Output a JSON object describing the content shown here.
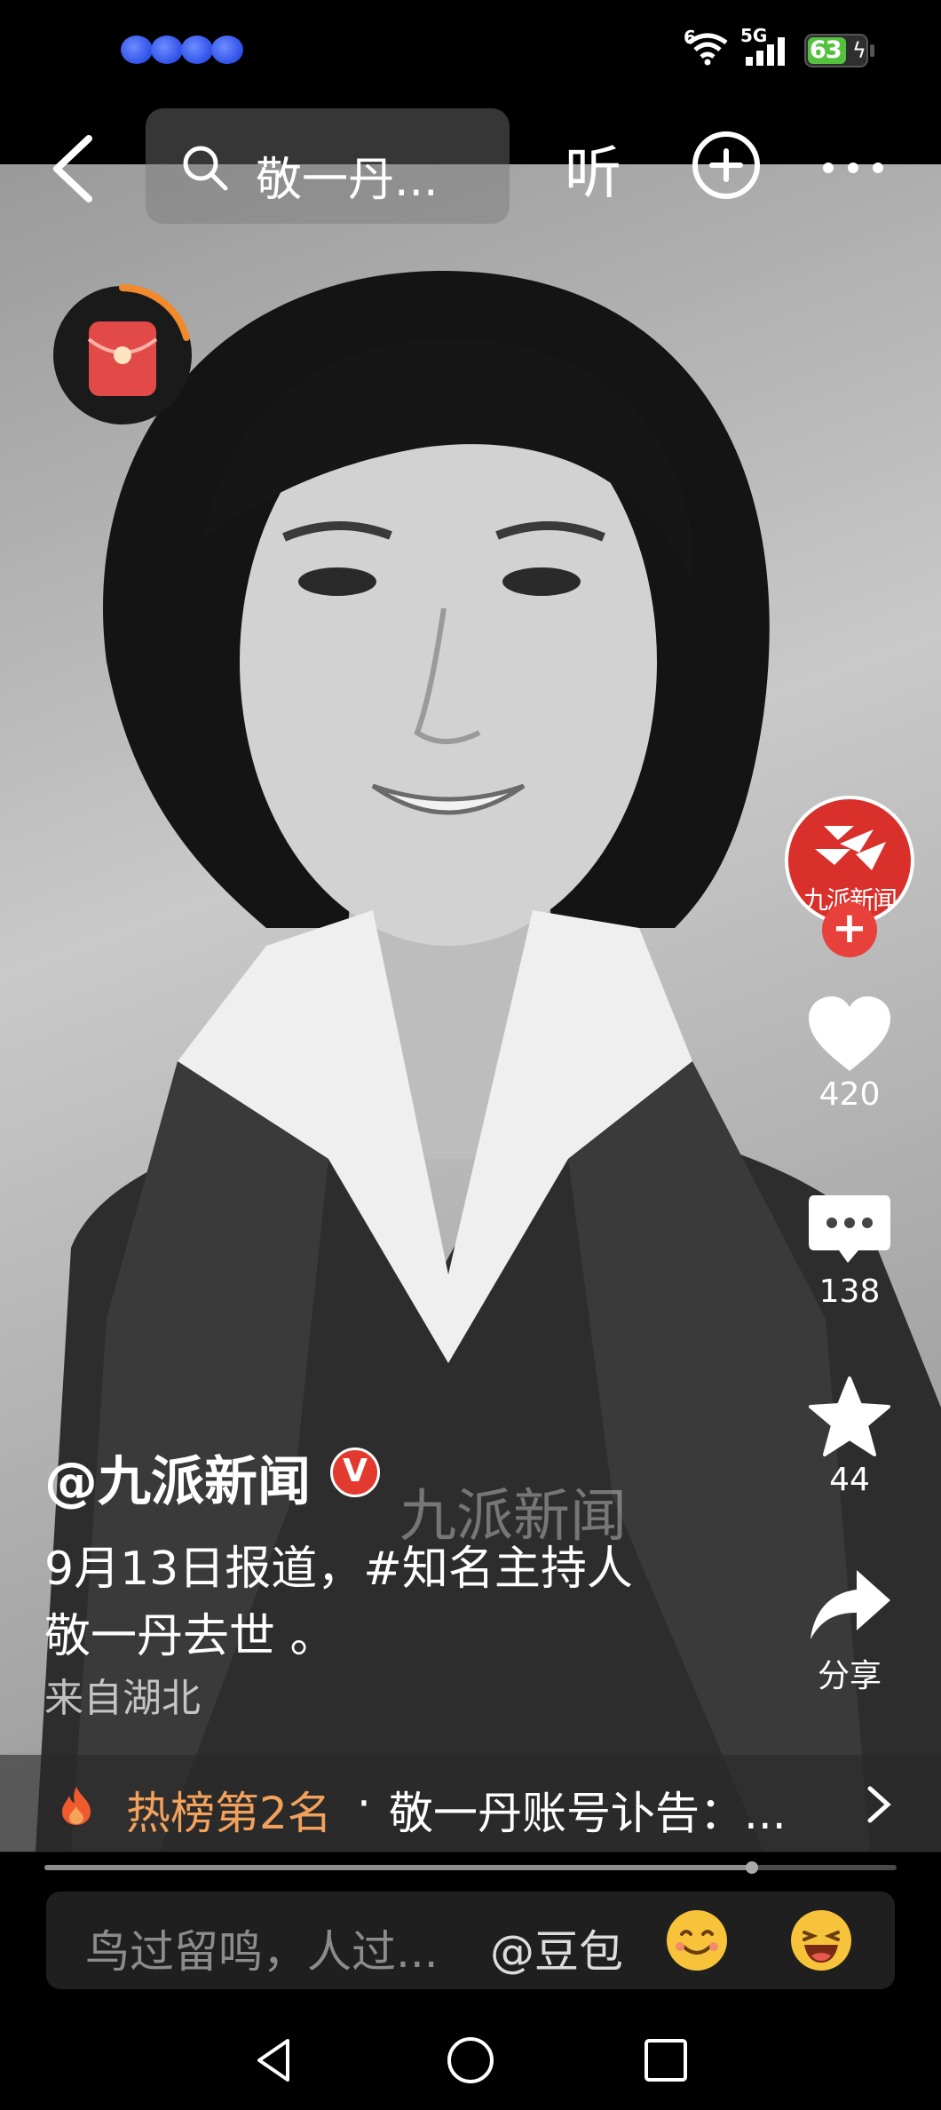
{
  "status_bar": {
    "wifi_badge": "6",
    "network": "5G",
    "battery": "63",
    "battery_level": 0.63
  },
  "top_bar": {
    "search_text": "敬一丹...",
    "listen_label": "听"
  },
  "creator": {
    "avatar_text": "九派新闻",
    "follow_label": "+"
  },
  "actions": {
    "like_count": "420",
    "comment_count": "138",
    "favorite_count": "44",
    "share_label": "分享"
  },
  "caption": {
    "author": "@九派新闻",
    "verified_badge": "V",
    "watermark": "九派新闻",
    "line1": "9月13日报道，#知名主持人",
    "line2": "敬一丹去世 。",
    "location": "来自湖北"
  },
  "hot_bar": {
    "rank_label": "热榜第2名",
    "separator": "·",
    "title": "敬一丹账号讣告：..."
  },
  "progress": {
    "value": 0.83
  },
  "comment_bar": {
    "placeholder": "鸟过留鸣，人过...",
    "mention": "@豆包"
  },
  "colors": {
    "accent_red": "#e23a2e",
    "hot_orange": "#f1a15c",
    "battery_green": "#55c23f"
  }
}
